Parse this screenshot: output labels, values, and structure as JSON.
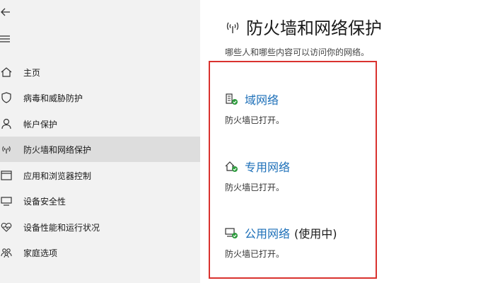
{
  "sidebar": {
    "items": [
      {
        "label": "主页",
        "icon": "home-icon"
      },
      {
        "label": "病毒和威胁防护",
        "icon": "shield-icon"
      },
      {
        "label": "帐户保护",
        "icon": "person-icon"
      },
      {
        "label": "防火墙和网络保护",
        "icon": "wifi-antenna-icon",
        "selected": true
      },
      {
        "label": "应用和浏览器控制",
        "icon": "app-window-icon"
      },
      {
        "label": "设备安全性",
        "icon": "device-icon"
      },
      {
        "label": "设备性能和运行状况",
        "icon": "heart-pulse-icon"
      },
      {
        "label": "家庭选项",
        "icon": "family-icon"
      }
    ]
  },
  "main": {
    "title": "防火墙和网络保护",
    "subtitle": "哪些人和哪些内容可以访问你的网络。",
    "networks": [
      {
        "name": "域网络",
        "suffix": "",
        "status": "防火墙已打开。",
        "icon": "domain-network-icon"
      },
      {
        "name": "专用网络",
        "suffix": "",
        "status": "防火墙已打开。",
        "icon": "private-network-icon"
      },
      {
        "name": "公用网络",
        "suffix": "(使用中)",
        "status": "防火墙已打开。",
        "icon": "public-network-icon"
      }
    ]
  },
  "colors": {
    "link": "#1c6fb8",
    "check": "#2e9b3e",
    "highlight": "#d9322e",
    "sidebar_bg": "#f2f2f2",
    "selected_bg": "#dddddd"
  }
}
